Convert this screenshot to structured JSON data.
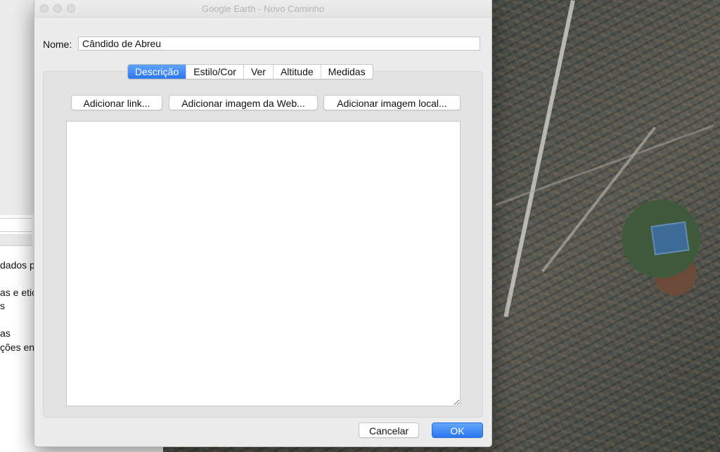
{
  "window": {
    "title": "Google Earth - Novo Caminho"
  },
  "form": {
    "name_label": "Nome:",
    "name_value": "Cândido de Abreu"
  },
  "tabs": [
    {
      "label": "Descrição",
      "active": true
    },
    {
      "label": "Estilo/Cor",
      "active": false
    },
    {
      "label": "Ver",
      "active": false
    },
    {
      "label": "Altitude",
      "active": false
    },
    {
      "label": "Medidas",
      "active": false
    }
  ],
  "description_toolbar": {
    "add_link": "Adicionar link...",
    "add_web_image": "Adicionar imagem da Web...",
    "add_local_image": "Adicionar imagem local..."
  },
  "footer": {
    "cancel": "Cancelar",
    "ok": "OK"
  },
  "background_window": {
    "lines": [
      "dados p",
      "as e etic",
      "s",
      "as",
      "ções en"
    ]
  },
  "colors": {
    "accent": "#2c77f0",
    "dialog_bg": "#ececec"
  }
}
